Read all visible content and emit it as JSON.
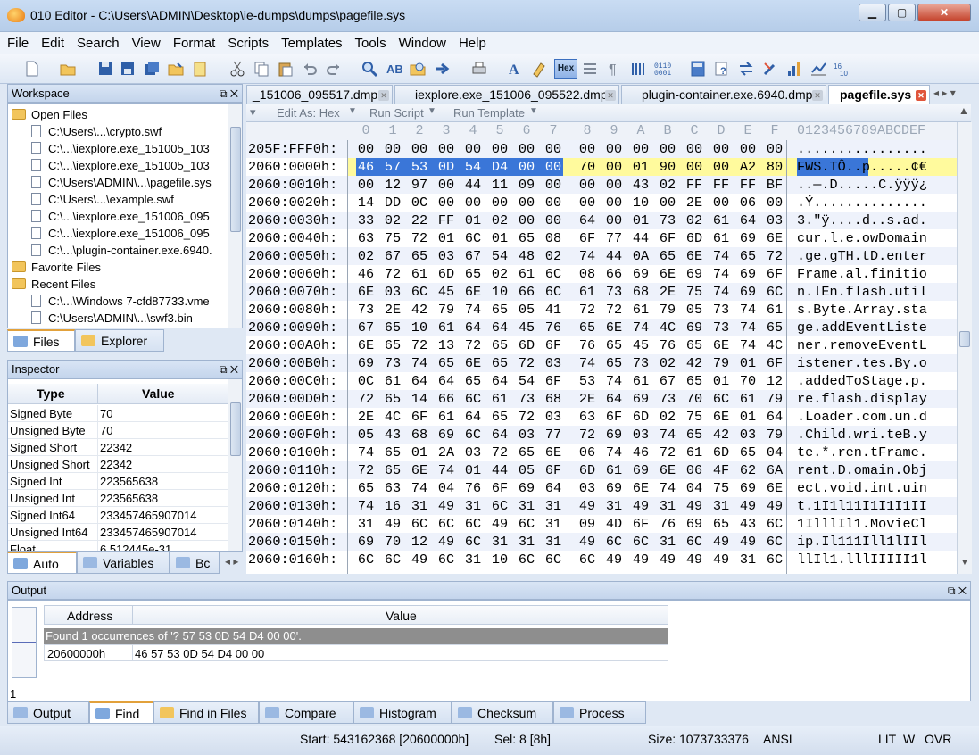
{
  "window": {
    "title": "010 Editor - C:\\Users\\ADMIN\\Desktop\\ie-dumps\\dumps\\pagefile.sys",
    "min_label": "▁",
    "max_label": "▢",
    "close_label": "✕"
  },
  "menu": [
    "File",
    "Edit",
    "Search",
    "View",
    "Format",
    "Scripts",
    "Templates",
    "Tools",
    "Window",
    "Help"
  ],
  "toolbar": {
    "hex_label": "Hex",
    "icons": [
      "new-file-icon",
      "open-file-icon",
      "save-icon",
      "save-as-icon",
      "save-all-icon",
      "open-folder-icon",
      "notes-icon",
      "cut-icon",
      "copy-icon",
      "paste-icon",
      "undo-icon",
      "redo-icon",
      "find-icon",
      "replace-icon",
      "find-in-files-icon",
      "goto-icon",
      "print-icon",
      "font-icon",
      "highlight-icon",
      "hex-mode-icon",
      "columns-icon",
      "paragraph-icon",
      "list-icon",
      "binary-icon",
      "calculator-icon",
      "help-icon",
      "compare-icon",
      "tools-icon",
      "chart-icon",
      "base-convert-icon"
    ]
  },
  "workspace": {
    "title": "Workspace",
    "open_files_label": "Open Files",
    "open_files": [
      "C:\\Users\\...\\crypto.swf",
      "C:\\...\\iexplore.exe_151005_103",
      "C:\\...\\iexplore.exe_151005_103",
      "C:\\Users\\ADMIN\\...\\pagefile.sys",
      "C:\\Users\\...\\example.swf",
      "C:\\...\\iexplore.exe_151006_095",
      "C:\\...\\iexplore.exe_151006_095",
      "C:\\...\\plugin-container.exe.6940."
    ],
    "favorite_label": "Favorite Files",
    "recent_label": "Recent Files",
    "recent_files": [
      "C:\\...\\Windows 7-cfd87733.vme",
      "C:\\Users\\ADMIN\\...\\swf3.bin"
    ],
    "tabs": [
      "Files",
      "Explorer"
    ]
  },
  "inspector": {
    "title": "Inspector",
    "col_type": "Type",
    "col_value": "Value",
    "rows": [
      {
        "type": "Signed Byte",
        "value": "70"
      },
      {
        "type": "Unsigned Byte",
        "value": "70"
      },
      {
        "type": "Signed Short",
        "value": "22342"
      },
      {
        "type": "Unsigned Short",
        "value": "22342"
      },
      {
        "type": "Signed Int",
        "value": "223565638"
      },
      {
        "type": "Unsigned Int",
        "value": "223565638"
      },
      {
        "type": "Signed Int64",
        "value": "233457465907014"
      },
      {
        "type": "Unsigned Int64",
        "value": "233457465907014"
      },
      {
        "type": "Float",
        "value": "6.512445e-31"
      }
    ],
    "tabs": [
      "Auto",
      "Variables",
      "Bc"
    ]
  },
  "doc_tabs": [
    {
      "label": "_151006_095517.dmp",
      "active": false
    },
    {
      "label": "iexplore.exe_151006_095522.dmp",
      "active": false
    },
    {
      "label": "plugin-container.exe.6940.dmp",
      "active": false
    },
    {
      "label": "pagefile.sys",
      "active": true
    }
  ],
  "editbar": {
    "edit_as": "Edit As: Hex",
    "run_script": "Run Script",
    "run_template": "Run Template"
  },
  "hex": {
    "col_headers": [
      "0",
      "1",
      "2",
      "3",
      "4",
      "5",
      "6",
      "7",
      "8",
      "9",
      "A",
      "B",
      "C",
      "D",
      "E",
      "F"
    ],
    "ascii_header": "0123456789ABCDEF",
    "rows": [
      {
        "addr": "205F:FFF0h:",
        "bytes": [
          "00",
          "00",
          "00",
          "00",
          "00",
          "00",
          "00",
          "00",
          "00",
          "00",
          "00",
          "00",
          "00",
          "00",
          "00",
          "00"
        ],
        "ascii": "................"
      },
      {
        "addr": "2060:0000h:",
        "bytes": [
          "46",
          "57",
          "53",
          "0D",
          "54",
          "D4",
          "00",
          "00",
          "70",
          "00",
          "01",
          "90",
          "00",
          "00",
          "A2",
          "80"
        ],
        "ascii": "FWS.TÔ..p.....¢€"
      },
      {
        "addr": "2060:0010h:",
        "bytes": [
          "00",
          "12",
          "97",
          "00",
          "44",
          "11",
          "09",
          "00",
          "00",
          "00",
          "43",
          "02",
          "FF",
          "FF",
          "FF",
          "BF"
        ],
        "ascii": "..—.D.....C.ÿÿÿ¿"
      },
      {
        "addr": "2060:0020h:",
        "bytes": [
          "14",
          "DD",
          "0C",
          "00",
          "00",
          "00",
          "00",
          "00",
          "00",
          "00",
          "10",
          "00",
          "2E",
          "00",
          "06",
          "00"
        ],
        "ascii": ".Ý.............."
      },
      {
        "addr": "2060:0030h:",
        "bytes": [
          "33",
          "02",
          "22",
          "FF",
          "01",
          "02",
          "00",
          "00",
          "64",
          "00",
          "01",
          "73",
          "02",
          "61",
          "64",
          "03"
        ],
        "ascii": "3.\"ÿ....d..s.ad."
      },
      {
        "addr": "2060:0040h:",
        "bytes": [
          "63",
          "75",
          "72",
          "01",
          "6C",
          "01",
          "65",
          "08",
          "6F",
          "77",
          "44",
          "6F",
          "6D",
          "61",
          "69",
          "6E"
        ],
        "ascii": "cur.l.e.owDomain"
      },
      {
        "addr": "2060:0050h:",
        "bytes": [
          "02",
          "67",
          "65",
          "03",
          "67",
          "54",
          "48",
          "02",
          "74",
          "44",
          "0A",
          "65",
          "6E",
          "74",
          "65",
          "72"
        ],
        "ascii": ".ge.gTH.tD.enter"
      },
      {
        "addr": "2060:0060h:",
        "bytes": [
          "46",
          "72",
          "61",
          "6D",
          "65",
          "02",
          "61",
          "6C",
          "08",
          "66",
          "69",
          "6E",
          "69",
          "74",
          "69",
          "6F"
        ],
        "ascii": "Frame.al.finitio"
      },
      {
        "addr": "2060:0070h:",
        "bytes": [
          "6E",
          "03",
          "6C",
          "45",
          "6E",
          "10",
          "66",
          "6C",
          "61",
          "73",
          "68",
          "2E",
          "75",
          "74",
          "69",
          "6C"
        ],
        "ascii": "n.lEn.flash.util"
      },
      {
        "addr": "2060:0080h:",
        "bytes": [
          "73",
          "2E",
          "42",
          "79",
          "74",
          "65",
          "05",
          "41",
          "72",
          "72",
          "61",
          "79",
          "05",
          "73",
          "74",
          "61"
        ],
        "ascii": "s.Byte.Array.sta"
      },
      {
        "addr": "2060:0090h:",
        "bytes": [
          "67",
          "65",
          "10",
          "61",
          "64",
          "64",
          "45",
          "76",
          "65",
          "6E",
          "74",
          "4C",
          "69",
          "73",
          "74",
          "65"
        ],
        "ascii": "ge.addEventListe"
      },
      {
        "addr": "2060:00A0h:",
        "bytes": [
          "6E",
          "65",
          "72",
          "13",
          "72",
          "65",
          "6D",
          "6F",
          "76",
          "65",
          "45",
          "76",
          "65",
          "6E",
          "74",
          "4C"
        ],
        "ascii": "ner.removeEventL"
      },
      {
        "addr": "2060:00B0h:",
        "bytes": [
          "69",
          "73",
          "74",
          "65",
          "6E",
          "65",
          "72",
          "03",
          "74",
          "65",
          "73",
          "02",
          "42",
          "79",
          "01",
          "6F"
        ],
        "ascii": "istener.tes.By.o"
      },
      {
        "addr": "2060:00C0h:",
        "bytes": [
          "0C",
          "61",
          "64",
          "64",
          "65",
          "64",
          "54",
          "6F",
          "53",
          "74",
          "61",
          "67",
          "65",
          "01",
          "70",
          "12"
        ],
        "ascii": ".addedToStage.p."
      },
      {
        "addr": "2060:00D0h:",
        "bytes": [
          "72",
          "65",
          "14",
          "66",
          "6C",
          "61",
          "73",
          "68",
          "2E",
          "64",
          "69",
          "73",
          "70",
          "6C",
          "61",
          "79"
        ],
        "ascii": "re.flash.display"
      },
      {
        "addr": "2060:00E0h:",
        "bytes": [
          "2E",
          "4C",
          "6F",
          "61",
          "64",
          "65",
          "72",
          "03",
          "63",
          "6F",
          "6D",
          "02",
          "75",
          "6E",
          "01",
          "64"
        ],
        "ascii": ".Loader.com.un.d"
      },
      {
        "addr": "2060:00F0h:",
        "bytes": [
          "05",
          "43",
          "68",
          "69",
          "6C",
          "64",
          "03",
          "77",
          "72",
          "69",
          "03",
          "74",
          "65",
          "42",
          "03",
          "79"
        ],
        "ascii": ".Child.wri.teB.y"
      },
      {
        "addr": "2060:0100h:",
        "bytes": [
          "74",
          "65",
          "01",
          "2A",
          "03",
          "72",
          "65",
          "6E",
          "06",
          "74",
          "46",
          "72",
          "61",
          "6D",
          "65",
          "04"
        ],
        "ascii": "te.*.ren.tFrame."
      },
      {
        "addr": "2060:0110h:",
        "bytes": [
          "72",
          "65",
          "6E",
          "74",
          "01",
          "44",
          "05",
          "6F",
          "6D",
          "61",
          "69",
          "6E",
          "06",
          "4F",
          "62",
          "6A"
        ],
        "ascii": "rent.D.omain.Obj"
      },
      {
        "addr": "2060:0120h:",
        "bytes": [
          "65",
          "63",
          "74",
          "04",
          "76",
          "6F",
          "69",
          "64",
          "03",
          "69",
          "6E",
          "74",
          "04",
          "75",
          "69",
          "6E"
        ],
        "ascii": "ect.void.int.uin"
      },
      {
        "addr": "2060:0130h:",
        "bytes": [
          "74",
          "16",
          "31",
          "49",
          "31",
          "6C",
          "31",
          "31",
          "49",
          "31",
          "49",
          "31",
          "49",
          "31",
          "49",
          "49"
        ],
        "ascii": "t.1I1l11I1I1I1II"
      },
      {
        "addr": "2060:0140h:",
        "bytes": [
          "31",
          "49",
          "6C",
          "6C",
          "6C",
          "49",
          "6C",
          "31",
          "09",
          "4D",
          "6F",
          "76",
          "69",
          "65",
          "43",
          "6C"
        ],
        "ascii": "1IlllIl1.MovieCl"
      },
      {
        "addr": "2060:0150h:",
        "bytes": [
          "69",
          "70",
          "12",
          "49",
          "6C",
          "31",
          "31",
          "31",
          "49",
          "6C",
          "6C",
          "31",
          "6C",
          "49",
          "49",
          "6C"
        ],
        "ascii": "ip.Il111Ill1lIIl"
      },
      {
        "addr": "2060:0160h:",
        "bytes": [
          "6C",
          "6C",
          "49",
          "6C",
          "31",
          "10",
          "6C",
          "6C",
          "6C",
          "49",
          "49",
          "49",
          "49",
          "49",
          "31",
          "6C"
        ],
        "ascii": "llIl1.lllIIIII1l"
      }
    ]
  },
  "output": {
    "title": "Output",
    "col_address": "Address",
    "col_value": "Value",
    "found_text": "Found 1 occurrences of '? 57 53 0D 54 D4 00 00'.",
    "result_address": "20600000h",
    "result_value": "46 57 53 0D 54 D4 00 00",
    "line_number": "1",
    "tabs": [
      "Output",
      "Find",
      "Find in Files",
      "Compare",
      "Histogram",
      "Checksum",
      "Process"
    ]
  },
  "status": {
    "start": "Start: 543162368 [20600000h]",
    "sel": "Sel: 8 [8h]",
    "size": "Size: 1073733376",
    "encoding": "ANSI",
    "lit": "LIT",
    "w": "W",
    "ovr": "OVR"
  }
}
